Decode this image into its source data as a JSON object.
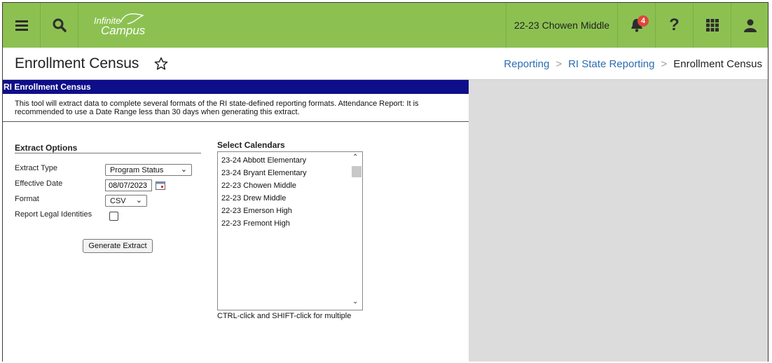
{
  "header": {
    "logo_line1": "Infinite",
    "logo_line2": "Campus",
    "school": "22-23 Chowen Middle",
    "notification_count": "4",
    "accent_color": "#8cc152",
    "icons": [
      "menu-icon",
      "search-icon",
      "bell-icon",
      "help-icon",
      "apps-grid-icon",
      "user-icon"
    ]
  },
  "title_row": {
    "title": "Enrollment Census",
    "breadcrumb": [
      "Reporting",
      "RI State Reporting",
      "Enrollment Census"
    ]
  },
  "panel": {
    "heading": "RI Enrollment Census",
    "heading_color": "#0e0e8a",
    "description_line1": "This tool will extract data to complete several formats of the RI state-defined reporting formats. Attendance Report: It is",
    "description_line2": "recommended to use a Date Range less than 30 days when generating this extract.",
    "extract_options": {
      "title": "Extract Options",
      "extract_type_label": "Extract Type",
      "extract_type_value": "Program Status",
      "effective_date_label": "Effective Date",
      "effective_date_value": "08/07/2023",
      "format_label": "Format",
      "format_value": "CSV",
      "legal_label": "Report Legal Identities",
      "legal_checked": false,
      "generate_button": "Generate Extract"
    },
    "calendars": {
      "title": "Select Calendars",
      "items": [
        "23-24 Abbott Elementary",
        "23-24 Bryant Elementary",
        "22-23 Chowen Middle",
        "22-23 Drew Middle",
        "22-23 Emerson High",
        "22-23 Fremont High"
      ],
      "hint": "CTRL-click and SHIFT-click for multiple"
    }
  }
}
